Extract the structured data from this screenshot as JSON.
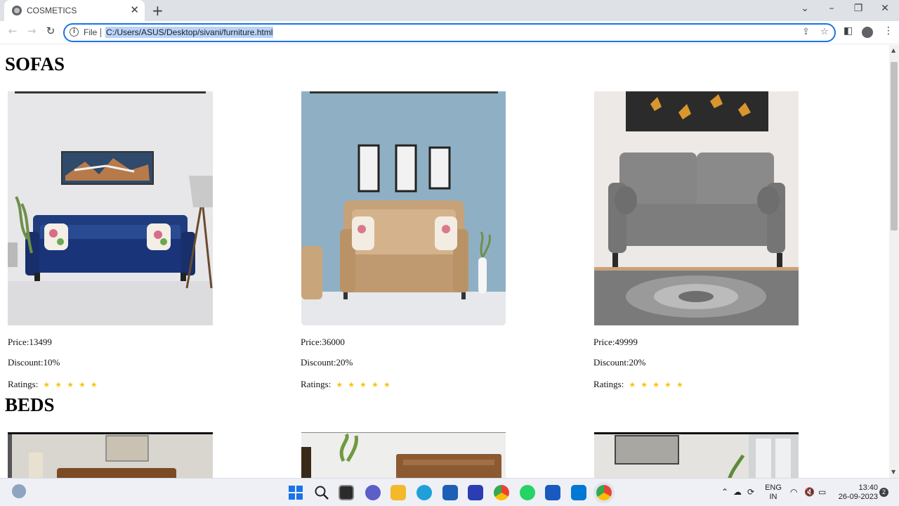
{
  "browser": {
    "tab_title": "COSMETICS",
    "tab_close": "✕",
    "new_tab": "+",
    "omnibox_scheme": "File",
    "url": "C:/Users/ASUS/Desktop/sivani/furniture.html",
    "accent_color": "#1a73e8"
  },
  "page": {
    "sections": [
      {
        "title": "SOFAS",
        "products": [
          {
            "price": "Price:13499",
            "discount": "Discount:10%",
            "ratings_label": "Ratings:",
            "stars": 5
          },
          {
            "price": "Price:36000",
            "discount": "Discount:20%",
            "ratings_label": "Ratings:",
            "stars": 5
          },
          {
            "price": "Price:49999",
            "discount": "Discount:20%",
            "ratings_label": "Ratings:",
            "stars": 5
          }
        ]
      },
      {
        "title": "BEDS",
        "products": [
          {
            "image": "bed-wooden-headboard"
          },
          {
            "image": "bed-rustic-headboard"
          },
          {
            "image": "bed-grey-room"
          }
        ]
      }
    ],
    "star_color": "#f5c518"
  },
  "taskbar": {
    "language_line1": "ENG",
    "language_line2": "IN",
    "time": "13:40",
    "date": "26-09-2023",
    "notification_count": "2"
  }
}
